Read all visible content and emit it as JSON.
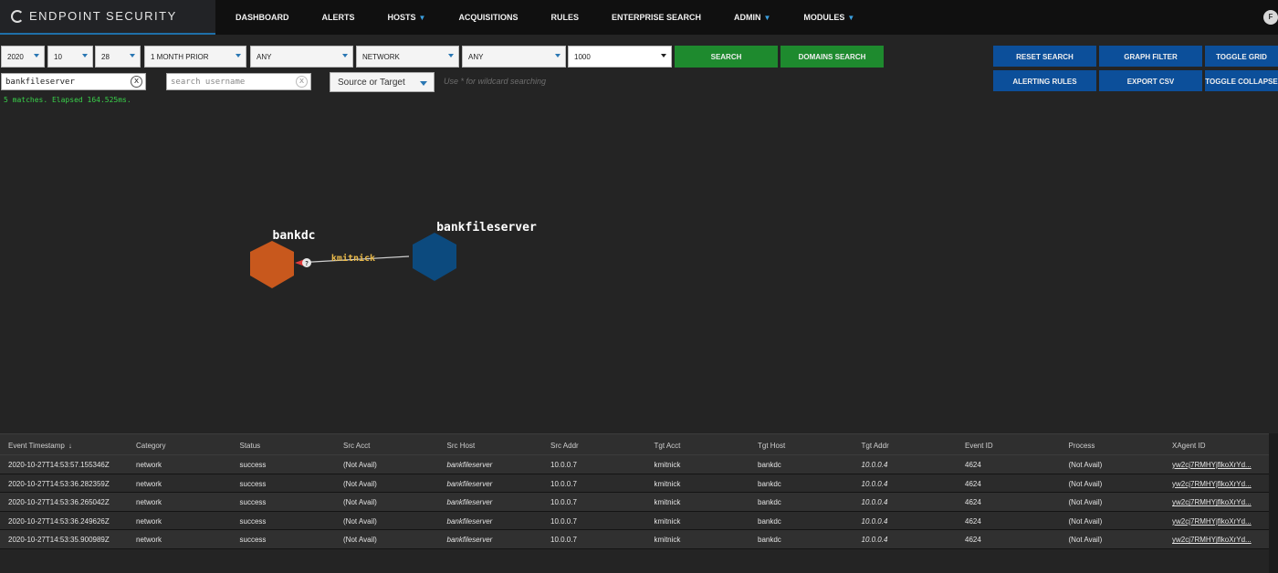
{
  "app": {
    "title": "ENDPOINT SECURITY",
    "user_initial": "F"
  },
  "nav": [
    {
      "label": "DASHBOARD",
      "dropdown": false
    },
    {
      "label": "ALERTS",
      "dropdown": false
    },
    {
      "label": "HOSTS",
      "dropdown": true
    },
    {
      "label": "ACQUISITIONS",
      "dropdown": false
    },
    {
      "label": "RULES",
      "dropdown": false
    },
    {
      "label": "ENTERPRISE SEARCH",
      "dropdown": false
    },
    {
      "label": "ADMIN",
      "dropdown": true
    },
    {
      "label": "MODULES",
      "dropdown": true
    }
  ],
  "filters": {
    "year": "2020",
    "month": "10",
    "day": "28",
    "range": "1 MONTH PRIOR",
    "category": "ANY",
    "type": "NETWORK",
    "status": "ANY",
    "limit": "1000"
  },
  "buttons": {
    "search": "SEARCH",
    "domains_search": "DOMAINS SEARCH",
    "reset_search": "RESET SEARCH",
    "graph_filter": "GRAPH FILTER",
    "toggle_grid": "TOGGLE GRID",
    "alerting_rules": "ALERTING RULES",
    "export_csv": "EXPORT CSV",
    "toggle_collapse": "TOGGLE COLLAPSE"
  },
  "search": {
    "host_value": "bankfileserver",
    "username_placeholder": "search username",
    "direction": "Source or Target",
    "hint": "Use * for wildcard searching",
    "clear_symbol": "x"
  },
  "status_text": "5 matches. Elapsed 164.525ms.",
  "graph": {
    "nodes": [
      {
        "label": "bankdc",
        "color": "#c8581d"
      },
      {
        "label": "bankfileserver",
        "color": "#0c4a7e"
      }
    ],
    "edge_label": "kmitnick",
    "edge_marker": "?"
  },
  "table": {
    "sort_icon": "↓",
    "columns": [
      "Event Timestamp",
      "Category",
      "Status",
      "Src Acct",
      "Src Host",
      "Src Addr",
      "Tgt Acct",
      "Tgt Host",
      "Tgt Addr",
      "Event ID",
      "Process",
      "XAgent ID"
    ],
    "rows": [
      [
        "2020-10-27T14:53:57.155346Z",
        "network",
        "success",
        "(Not Avail)",
        "bankfileserver",
        "10.0.0.7",
        "kmitnick",
        "bankdc",
        "10.0.0.4",
        "4624",
        "(Not Avail)",
        "yw2cj7RMHYjflkoXrYd..."
      ],
      [
        "2020-10-27T14:53:36.282359Z",
        "network",
        "success",
        "(Not Avail)",
        "bankfileserver",
        "10.0.0.7",
        "kmitnick",
        "bankdc",
        "10.0.0.4",
        "4624",
        "(Not Avail)",
        "yw2cj7RMHYjflkoXrYd..."
      ],
      [
        "2020-10-27T14:53:36.265042Z",
        "network",
        "success",
        "(Not Avail)",
        "bankfileserver",
        "10.0.0.7",
        "kmitnick",
        "bankdc",
        "10.0.0.4",
        "4624",
        "(Not Avail)",
        "yw2cj7RMHYjflkoXrYd..."
      ],
      [
        "2020-10-27T14:53:36.249626Z",
        "network",
        "success",
        "(Not Avail)",
        "bankfileserver",
        "10.0.0.7",
        "kmitnick",
        "bankdc",
        "10.0.0.4",
        "4624",
        "(Not Avail)",
        "yw2cj7RMHYjflkoXrYd..."
      ],
      [
        "2020-10-27T14:53:35.900989Z",
        "network",
        "success",
        "(Not Avail)",
        "bankfileserver",
        "10.0.0.7",
        "kmitnick",
        "bankdc",
        "10.0.0.4",
        "4624",
        "(Not Avail)",
        "yw2cj7RMHYjflkoXrYd..."
      ]
    ]
  }
}
